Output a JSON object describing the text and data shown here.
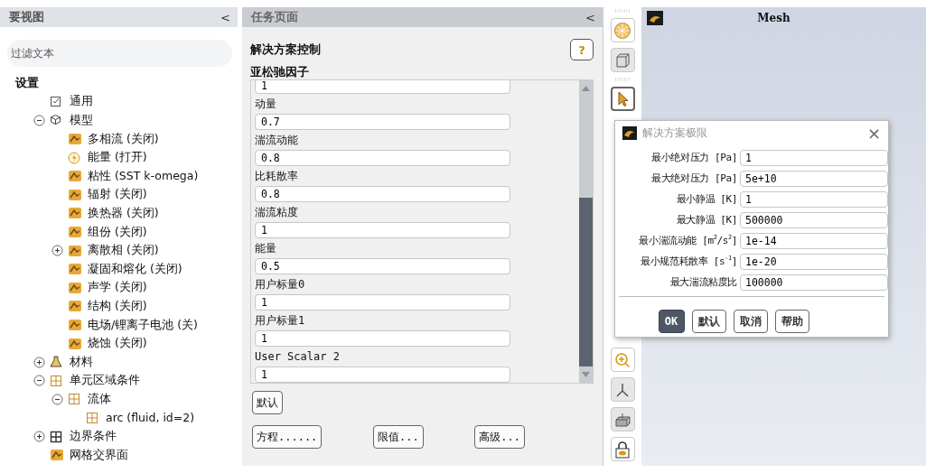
{
  "outline": {
    "title": "要视图",
    "collapse": "<",
    "filter": {
      "placeholder": "过滤文本"
    },
    "tree": [
      {
        "label": "设置",
        "kind": "heading",
        "children": [
          {
            "label": "通用",
            "kind": "check"
          },
          {
            "label": "模型",
            "kind": "cube",
            "expanded": true,
            "children": [
              {
                "label": "多相流 (关闭)",
                "kind": "model"
              },
              {
                "label": "能量 (打开)",
                "kind": "bolt"
              },
              {
                "label": "粘性 (SST k-omega)",
                "kind": "model"
              },
              {
                "label": "辐射 (关闭)",
                "kind": "model"
              },
              {
                "label": "换热器 (关闭)",
                "kind": "model"
              },
              {
                "label": "组份 (关闭)",
                "kind": "model"
              },
              {
                "label": "离散相 (关闭)",
                "kind": "model",
                "expanded": false
              },
              {
                "label": "凝固和熔化 (关闭)",
                "kind": "model"
              },
              {
                "label": "声学 (关闭)",
                "kind": "model"
              },
              {
                "label": "结构 (关闭)",
                "kind": "model"
              },
              {
                "label": "电场/锂离子电池 (关)",
                "kind": "model"
              },
              {
                "label": "烧蚀 (关闭)",
                "kind": "model"
              }
            ]
          },
          {
            "label": "材料",
            "kind": "flask",
            "expanded": false
          },
          {
            "label": "单元区域条件",
            "kind": "grid",
            "expanded": true,
            "children": [
              {
                "label": "流体",
                "kind": "grid",
                "expanded": true,
                "children": [
                  {
                    "label": "arc (fluid, id=2)",
                    "kind": "grid"
                  }
                ]
              }
            ]
          },
          {
            "label": "边界条件",
            "kind": "grid-dark",
            "expanded": false
          },
          {
            "label": "网格交界面",
            "kind": "model"
          }
        ]
      }
    ]
  },
  "task_page": {
    "title": "任务页面",
    "collapse": "<",
    "heading": "解决方案控制",
    "help": "?",
    "section": "亚松驰因子",
    "fields": [
      {
        "value": "1"
      },
      {
        "label": "动量",
        "value": "0.7"
      },
      {
        "label": "湍流动能",
        "value": "0.8"
      },
      {
        "label": "比耗散率",
        "value": "0.8"
      },
      {
        "label": "湍流粘度",
        "value": "1"
      },
      {
        "label": "能量",
        "value": "0.5"
      },
      {
        "label": "用户标量0",
        "value": "1"
      },
      {
        "label": "用户标量1",
        "value": "1"
      },
      {
        "label": "User Scalar 2",
        "value": "1"
      }
    ],
    "default_button": "默认",
    "buttons": [
      "方程......",
      "限值...",
      "高级..."
    ]
  },
  "graphics": {
    "title": "Mesh"
  },
  "dialog": {
    "title": "解决方案极限",
    "close": "×",
    "rows": [
      {
        "label": "最小绝对压力 [Pa]",
        "value": "1"
      },
      {
        "label": "最大绝对压力 [Pa]",
        "value": "5e+10"
      },
      {
        "label": "最小静温 [K]",
        "value": "1"
      },
      {
        "label": "最大静温 [K]",
        "value": "500000"
      },
      {
        "label": "最小湍流动能 [m$^{2}$/s$^{2}$]",
        "value": "1e-14"
      },
      {
        "label": "最小规范耗散率 [s$^{-1}$]",
        "value": "1e-20"
      },
      {
        "label": "最大湍流粘度比",
        "value": "100000"
      }
    ],
    "buttons": [
      {
        "label": "OK",
        "primary": true
      },
      {
        "label": "默认",
        "primary": false
      },
      {
        "label": "取消",
        "primary": false
      },
      {
        "label": "帮助",
        "primary": false
      }
    ]
  }
}
